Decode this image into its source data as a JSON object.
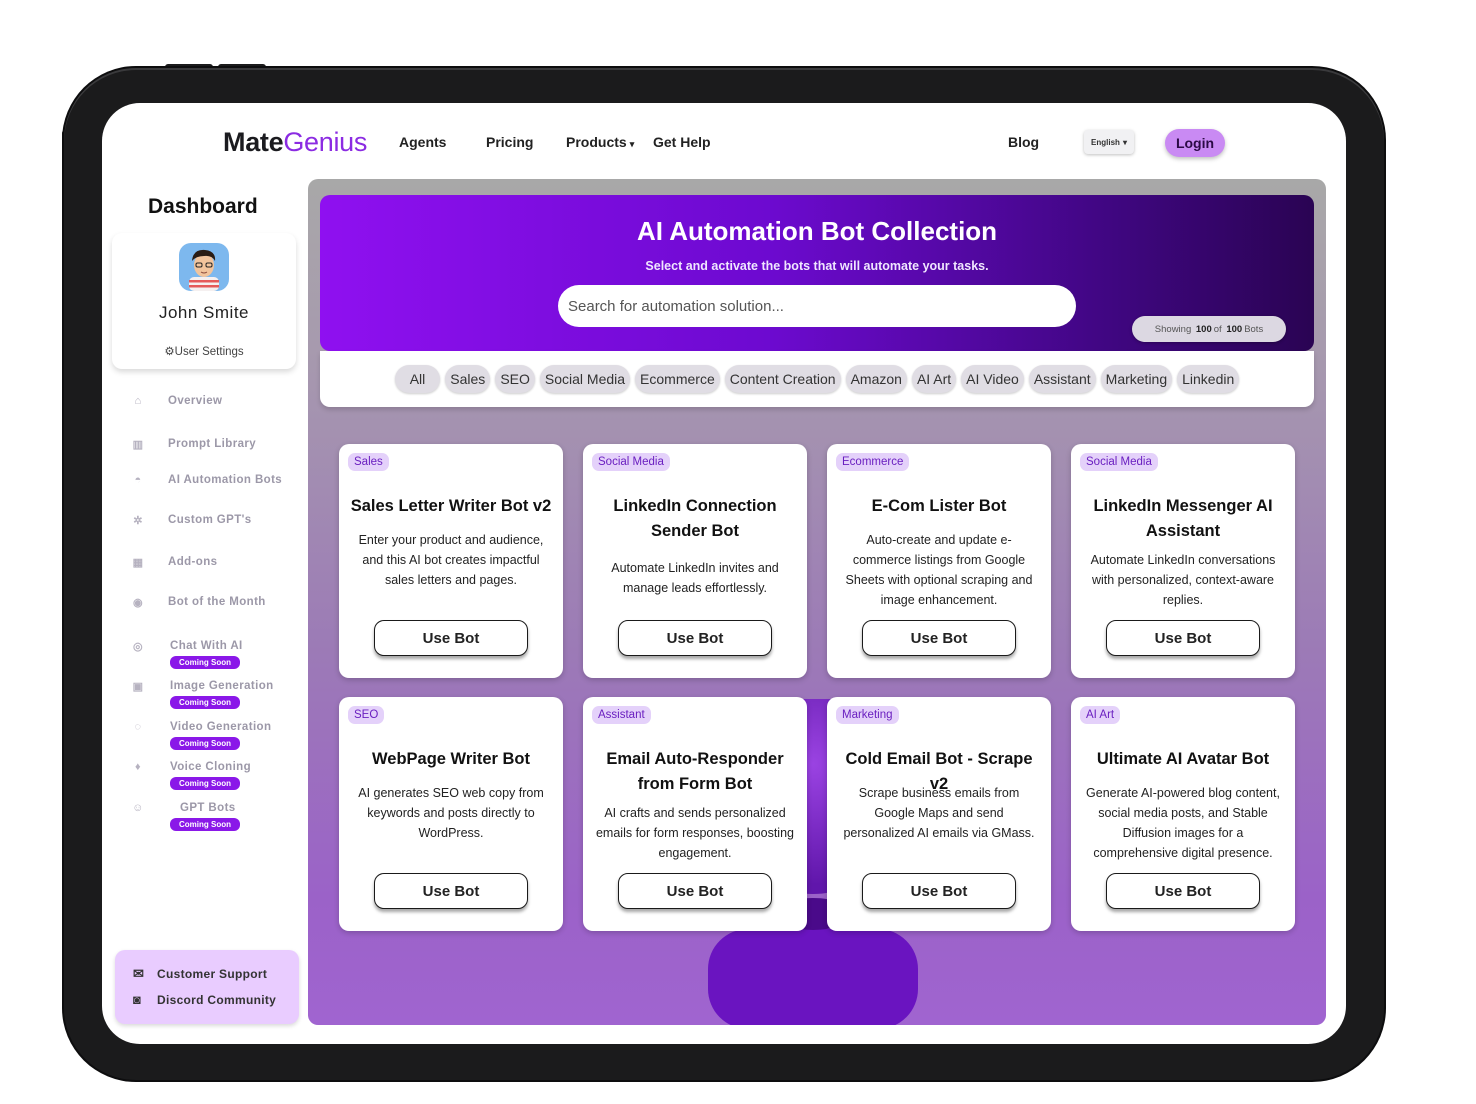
{
  "header": {
    "logo_main": "Mate",
    "logo_accent": "Genius",
    "nav": [
      "Agents",
      "Pricing",
      "Products",
      "Get Help"
    ],
    "blog": "Blog",
    "language": "English",
    "login": "Login"
  },
  "sidebar": {
    "title": "Dashboard",
    "user_name": "John Smite",
    "settings": "User Settings",
    "menu": [
      "Overview",
      "Prompt Library",
      "AI Automation Bots",
      "Custom GPT's",
      "Add-ons",
      "Bot of the Month"
    ],
    "coming": [
      "Chat With AI",
      "Image Generation",
      "Video Generation",
      "Voice Cloning",
      "GPT Bots"
    ],
    "coming_badge": "Coming Soon",
    "support": "Customer Support",
    "discord": "Discord Community"
  },
  "hero": {
    "title": "AI Automation Bot Collection",
    "subtitle": "Select and activate the bots that will automate your tasks.",
    "search_placeholder": "Search for automation solution...",
    "showing_prefix": "Showing",
    "showing_count": "100",
    "showing_of": "of",
    "showing_total": "100",
    "showing_suffix": "Bots"
  },
  "filters": [
    "All",
    "Sales",
    "SEO",
    "Social Media",
    "Ecommerce",
    "Content Creation",
    "Amazon",
    "AI Art",
    "AI Video",
    "Assistant",
    "Marketing",
    "Linkedin"
  ],
  "cards": [
    {
      "tag": "Sales",
      "title": "Sales Letter Writer Bot v2",
      "desc": "Enter your product and audience, and this AI bot creates impactful sales letters and pages.",
      "button": "Use Bot"
    },
    {
      "tag": "Social Media",
      "title": "LinkedIn Connection Sender Bot",
      "desc": "Automate LinkedIn invites and manage leads effortlessly.",
      "button": "Use Bot"
    },
    {
      "tag": "Ecommerce",
      "title": "E-Com Lister Bot",
      "desc": "Auto-create and update e-commerce listings from Google Sheets with optional scraping and image enhancement.",
      "button": "Use Bot"
    },
    {
      "tag": "Social Media",
      "title": "LinkedIn Messenger AI Assistant",
      "desc": "Automate LinkedIn conversations with personalized, context-aware replies.",
      "button": "Use Bot"
    },
    {
      "tag": "SEO",
      "title": "WebPage Writer Bot",
      "desc": "AI generates SEO web copy from keywords and posts directly to WordPress.",
      "button": "Use Bot"
    },
    {
      "tag": "Assistant",
      "title": "Email Auto-Responder from Form Bot",
      "desc": "AI crafts and sends personalized emails for form responses, boosting engagement.",
      "button": "Use Bot"
    },
    {
      "tag": "Marketing",
      "title": "Cold Email Bot - Scrape v2",
      "desc": "Scrape business emails from Google Maps and send personalized AI emails via GMass.",
      "button": "Use Bot"
    },
    {
      "tag": "AI Art",
      "title": "Ultimate AI Avatar Bot",
      "desc": "Generate AI-powered blog content, social media posts, and Stable Diffusion images for a comprehensive digital presence.",
      "button": "Use Bot"
    }
  ],
  "colors": {
    "accent": "#8b2be2",
    "hero_start": "#8f10f0",
    "hero_end": "#2a0453",
    "badge": "#8a18e8",
    "tag_bg": "#e4d1fa"
  }
}
